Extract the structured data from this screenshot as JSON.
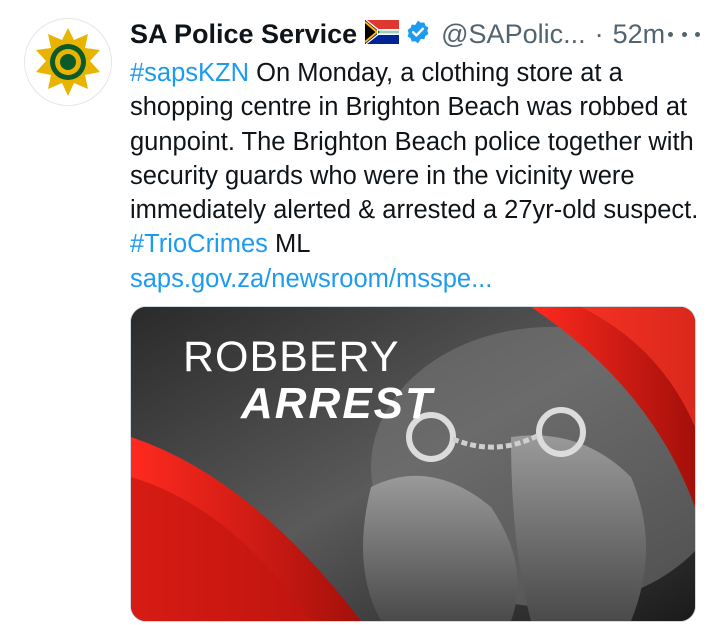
{
  "tweet": {
    "author_name": "SA Police Service",
    "flag_icon": "south-africa-flag-icon",
    "verified_icon": "verified-badge-icon",
    "handle": "@SAPolic...",
    "separator": "·",
    "time": "52m",
    "more_icon": "more-options-icon",
    "text": {
      "hashtag1": "#sapsKZN",
      "body": " On Monday, a  clothing store at a shopping centre in Brighton Beach was robbed at gunpoint. The Brighton Beach police together with security guards who were in the vicinity were immediately alerted & arrested a 27yr-old suspect. ",
      "hashtag2": "#TrioCrimes",
      "suffix": " ML",
      "link": "saps.gov.za/newsroom/msspe..."
    },
    "media": {
      "line1": "ROBBERY",
      "line2": "ARREST"
    }
  },
  "colors": {
    "accent": "#1d9bf0",
    "verified": "#1d9bf0",
    "media_red": "#e0201b"
  }
}
